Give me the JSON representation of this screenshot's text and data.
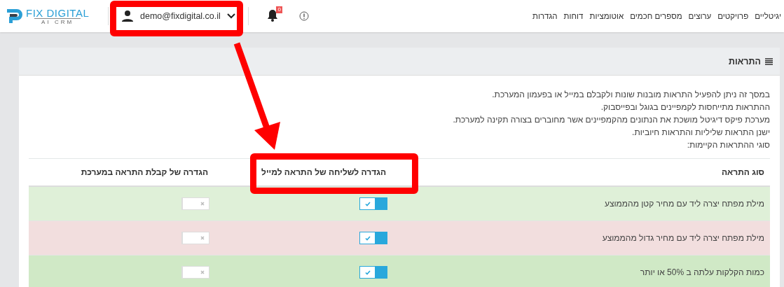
{
  "logo": {
    "name": "FIX DIGITAL",
    "tagline": "AI CRM"
  },
  "user_menu": {
    "email": "demo@fixdigital.co.il"
  },
  "notifications": {
    "count": "0"
  },
  "nav": [
    "יגיטליים",
    "פרויקטים",
    "ערוצים",
    "מספרים חכמים",
    "אוטומציות",
    "דוחות",
    "הגדרות"
  ],
  "panel": {
    "title": "התראות",
    "description": [
      "במסך זה ניתן להפעיל התראות מובנות שונות ולקבלם במייל או בפעמון המערכת.",
      "ההתראות מתייחסות לקמפיינים בגוגל ובפייסבוק.",
      "מערכת פיקס דיגיטל מושכת את הנתונים מהקמפיינים אשר מחוברים בצורה תקינה למערכת.",
      "ישנן התראות שליליות והתראות חיוביות.",
      "סוגי ההתראות הקיימות:"
    ]
  },
  "table": {
    "columns": [
      "סוג התראה",
      "הגדרה לשליחה של התראה למייל",
      "הגדרה של קבלת התראה במערכת"
    ],
    "rows": [
      {
        "type": "מילת מפתח יצרה ליד עם מחיר קטן מהממוצע",
        "color": "#dff0d8",
        "email_on": true,
        "system_on": false
      },
      {
        "type": "מילת מפתח יצרה ליד עם מחיר גדול מהממוצע",
        "color": "#f2dede",
        "email_on": true,
        "system_on": false
      },
      {
        "type": "כמות הקלקות עלתה ב 50% או יותר",
        "color": "#d0e9c6",
        "email_on": true,
        "system_on": false
      }
    ]
  }
}
